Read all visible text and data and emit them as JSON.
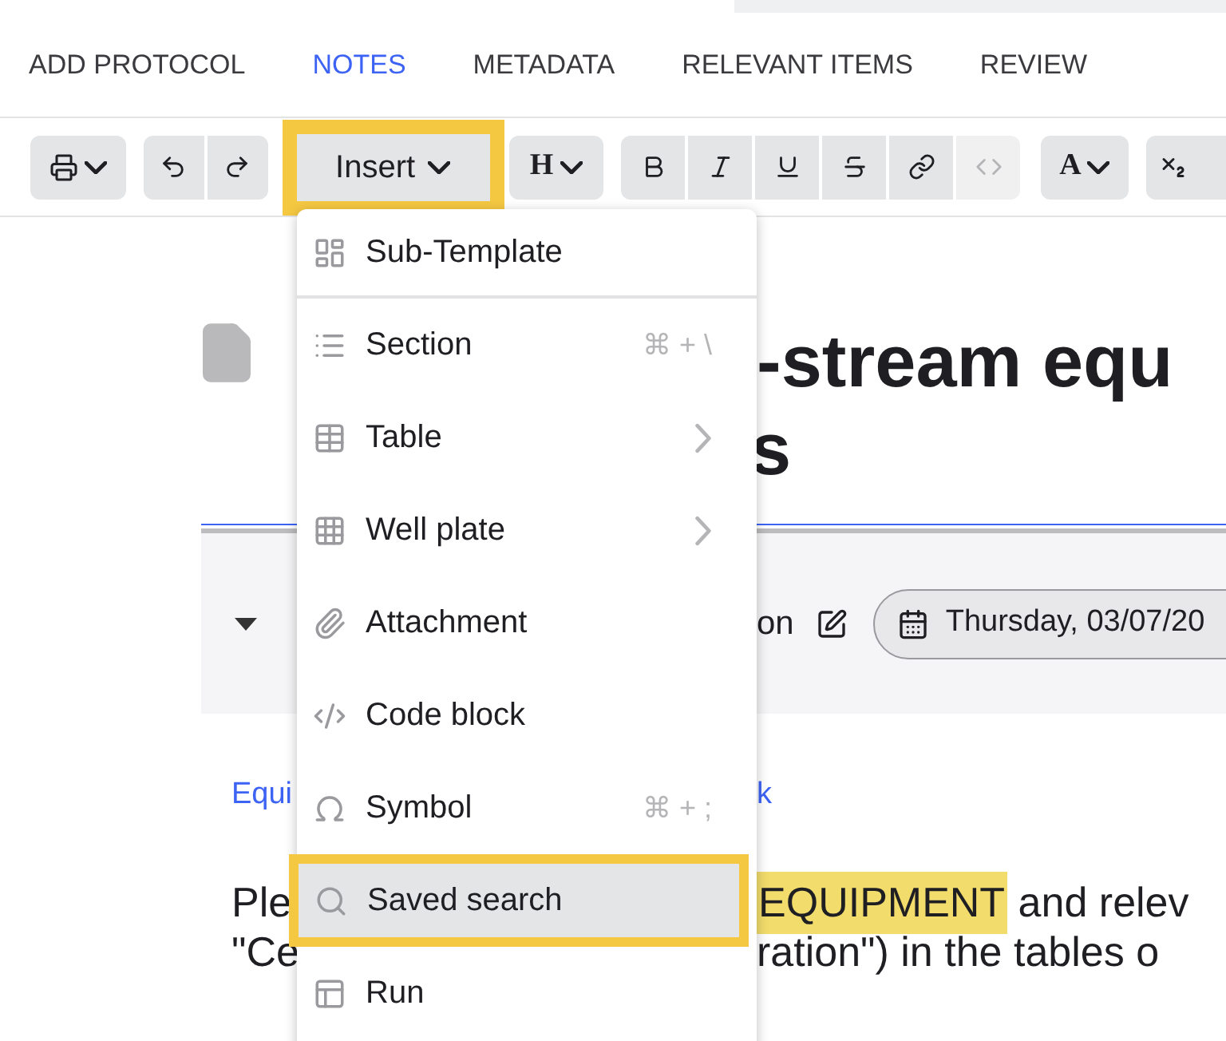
{
  "tabs": [
    {
      "label": "ADD PROTOCOL",
      "selected": false
    },
    {
      "label": "NOTES",
      "selected": true
    },
    {
      "label": "METADATA",
      "selected": false
    },
    {
      "label": "RELEVANT ITEMS",
      "selected": false
    },
    {
      "label": "REVIEW",
      "selected": false
    }
  ],
  "toolbar": {
    "insert": {
      "label": "Insert",
      "outlined": true
    },
    "heading": "H",
    "font_color": "A",
    "format_buttons": [
      {
        "disabled": false
      },
      {
        "disabled": false
      },
      {
        "disabled": false
      },
      {
        "disabled": false
      },
      {
        "disabled": false
      },
      {
        "disabled": true
      }
    ]
  },
  "menu": {
    "items": [
      {
        "label": "Sub-Template",
        "submenu": false,
        "selected": false,
        "outlined": false
      },
      {
        "label": "Section",
        "shortcut": "⌘ + \\",
        "submenu": false,
        "selected": false,
        "outlined": false
      },
      {
        "label": "Table",
        "submenu": true,
        "selected": false,
        "outlined": false
      },
      {
        "label": "Well plate",
        "submenu": true,
        "selected": false,
        "outlined": false
      },
      {
        "label": "Attachment",
        "submenu": false,
        "selected": false,
        "outlined": false
      },
      {
        "label": "Code block",
        "submenu": false,
        "selected": false,
        "outlined": false
      },
      {
        "label": "Symbol",
        "shortcut": "⌘ + ;",
        "submenu": false,
        "selected": false,
        "outlined": false
      },
      {
        "label": "Saved search",
        "submenu": false,
        "selected": true,
        "outlined": true
      },
      {
        "label": "Run",
        "submenu": false,
        "selected": false,
        "outlined": false
      }
    ]
  },
  "document": {
    "title_lines": [
      "-stream equ",
      "s"
    ],
    "section": {
      "label": "on",
      "date": "Thursday, 03/07/20"
    },
    "links": [
      "Equi",
      "k"
    ],
    "paragraph": [
      {
        "left": "Ple",
        "highlight": "EQUIPMENT",
        "right": " and relev"
      },
      {
        "left": "\"Ce",
        "right": "ration\") in the tables o"
      }
    ]
  }
}
